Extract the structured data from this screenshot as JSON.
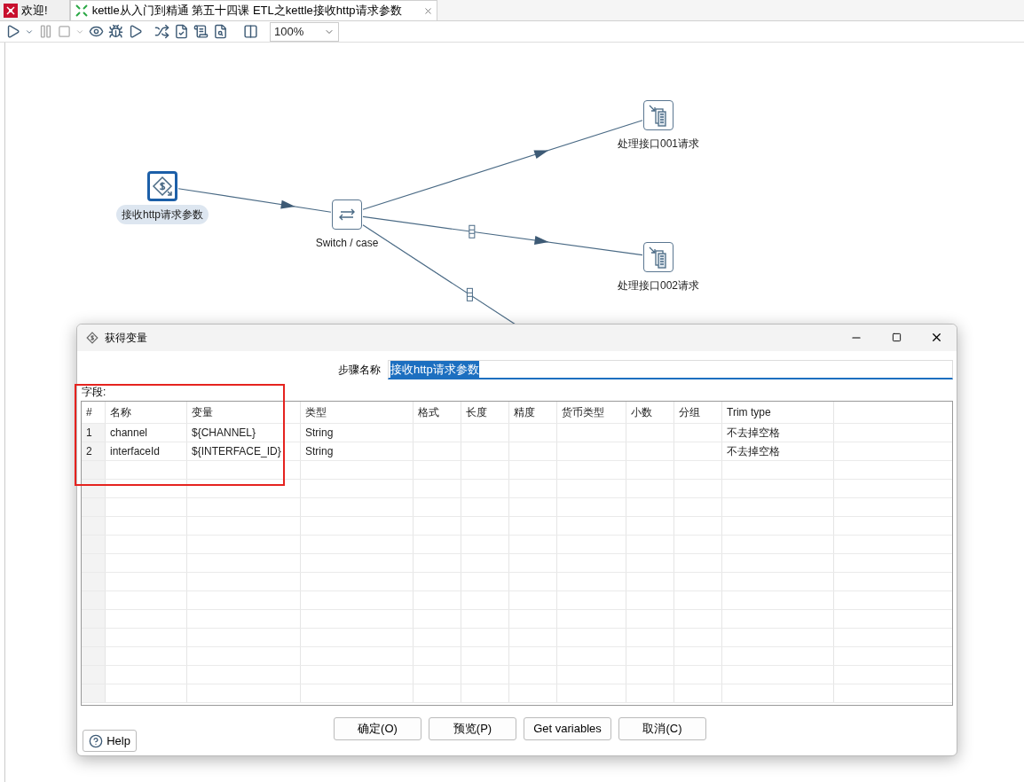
{
  "tabs": [
    {
      "label": "欢迎!",
      "selected": false,
      "closable": false
    },
    {
      "label": "kettle从入门到精通 第五十四课 ETL之kettle接收http请求参数",
      "selected": true,
      "closable": true
    }
  ],
  "toolbar": {
    "zoom": "100%"
  },
  "canvas": {
    "steps": [
      {
        "label": "接收http请求参数",
        "kind": "variables",
        "selected": true
      },
      {
        "label": "Switch / case",
        "kind": "switch",
        "selected": false
      },
      {
        "label": "处理接口001请求",
        "kind": "process",
        "selected": false
      },
      {
        "label": "处理接口002请求",
        "kind": "process",
        "selected": false
      }
    ]
  },
  "dialog": {
    "title": "获得变量",
    "step_name_label": "步骤名称",
    "step_name": "接收http请求参数",
    "step_name_selected": true,
    "fields_label": "字段:",
    "table": {
      "columns": [
        "#",
        "名称",
        "变量",
        "类型",
        "格式",
        "长度",
        "精度",
        "货币类型",
        "小数",
        "分组",
        "Trim type"
      ],
      "rows": [
        {
          "num": "1",
          "name": "channel",
          "variable": "${CHANNEL}",
          "type": "String",
          "trim_type": "不去掉空格"
        },
        {
          "num": "2",
          "name": "interfaceId",
          "variable": "${INTERFACE_ID}",
          "type": "String",
          "trim_type": "不去掉空格"
        }
      ]
    },
    "buttons": [
      "确定(O)",
      "预览(P)",
      "Get variables",
      "取消(C)"
    ],
    "help": "Help"
  }
}
